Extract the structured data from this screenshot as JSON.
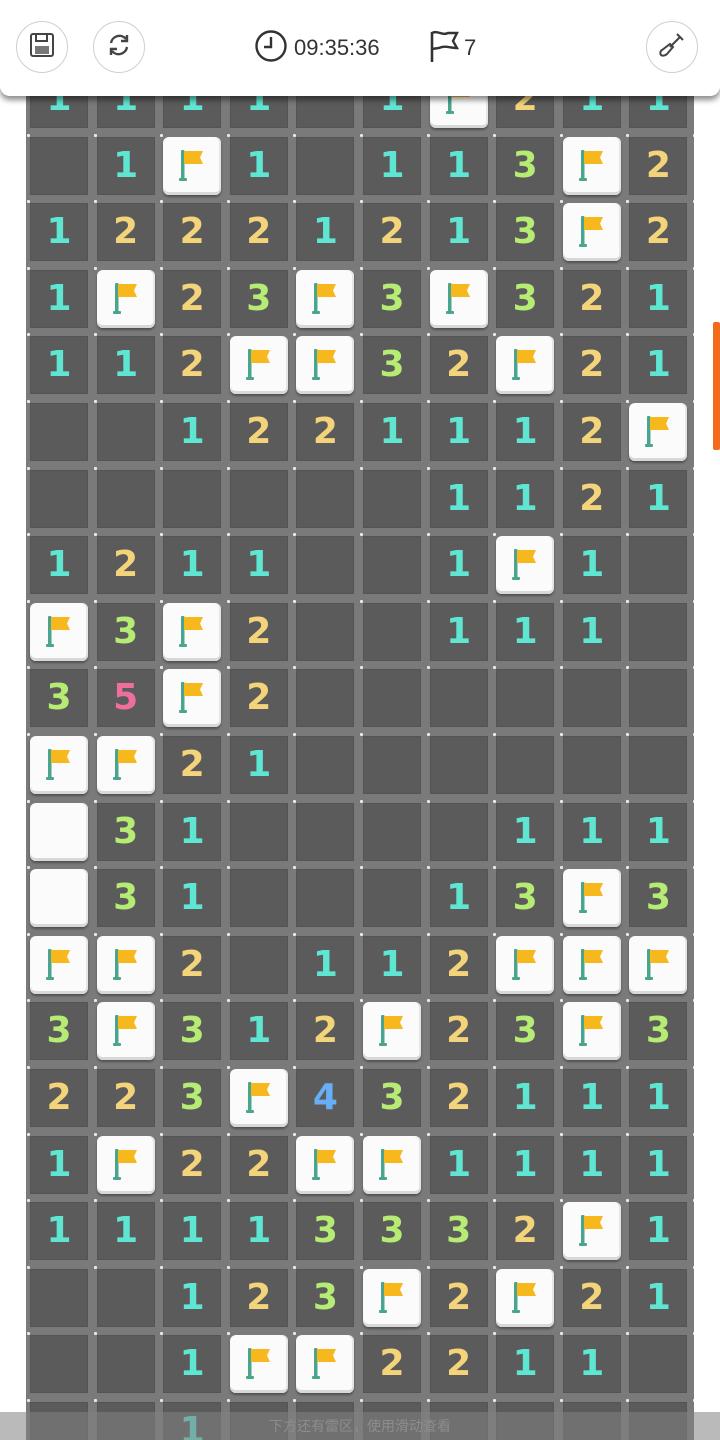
{
  "header": {
    "save_icon": "save-icon",
    "restart_icon": "restart-icon",
    "timer": "09:35:36",
    "flags_left": "7",
    "dig_icon": "shovel-icon"
  },
  "colors": {
    "1": "#5fe6d2",
    "2": "#f4d47a",
    "3": "#b6ec74",
    "4": "#68aef5",
    "5": "#ee6f9e",
    "flag": "#f7b81e",
    "pole": "#4aa58e",
    "accent": "#f26a1b"
  },
  "board": {
    "columns": 10,
    "legend": "F = flagged, H = unopened, . = opened empty, digit = adjacent mines",
    "rows": [
      "11111.1F211",
      "..1F1.113F2",
      "1222121 3F2",
      "1F23F3F321",
      "112FF32F21",
      "..122111 2F",
      "......1121",
      "1211..1F1.",
      "F3F2..111.",
      "35F2......",
      "FF21......",
      "H31....111",
      "H31...13F3",
      "FF2.112FFF",
      "3F312F23F3",
      "2230F4321 11",
      "1F22FF1111",
      "11113332F1",
      "..123F2F21",
      "..1FF22 11."
    ],
    "grid": [
      [
        "1",
        "1",
        "1",
        "1",
        ".",
        "1",
        "F",
        "2",
        "1",
        "1"
      ],
      [
        ".",
        "1",
        "F",
        "1",
        ".",
        "1",
        "1",
        "3",
        "F",
        "2"
      ],
      [
        "1",
        "2",
        "2",
        "2",
        "1",
        "2",
        "1",
        "3",
        "F",
        "2"
      ],
      [
        "1",
        "F",
        "2",
        "3",
        "F",
        "3",
        "F",
        "3",
        "2",
        "1"
      ],
      [
        "1",
        "1",
        "2",
        "F",
        "F",
        "3",
        "2",
        "F",
        "2",
        "1"
      ],
      [
        ".",
        ".",
        "1",
        "2",
        "2",
        "1",
        "1",
        "1",
        "2",
        "F"
      ],
      [
        ".",
        ".",
        ".",
        ".",
        ".",
        ".",
        "1",
        "1",
        "2",
        "1"
      ],
      [
        "1",
        "2",
        "1",
        "1",
        ".",
        ".",
        "1",
        "F",
        "1",
        "."
      ],
      [
        "F",
        "3",
        "F",
        "2",
        ".",
        ".",
        "1",
        "1",
        "1",
        "."
      ],
      [
        "3",
        "5",
        "F",
        "2",
        ".",
        ".",
        ".",
        ".",
        ".",
        "."
      ],
      [
        "F",
        "F",
        "2",
        "1",
        ".",
        ".",
        ".",
        ".",
        ".",
        "."
      ],
      [
        "H",
        "3",
        "1",
        ".",
        ".",
        ".",
        ".",
        "1",
        "1",
        "1"
      ],
      [
        "H",
        "3",
        "1",
        ".",
        ".",
        ".",
        "1",
        "3",
        "F",
        "3"
      ],
      [
        "F",
        "F",
        "2",
        ".",
        "1",
        "1",
        "2",
        "F",
        "F",
        "F"
      ],
      [
        "3",
        "F",
        "3",
        "1",
        "2",
        "F",
        "2",
        "3",
        "F",
        "3"
      ],
      [
        "2",
        "2",
        "3",
        "F",
        "4",
        "3",
        "2",
        "1",
        "1",
        "1"
      ],
      [
        "1",
        "F",
        "2",
        "2",
        "F",
        "F",
        "1",
        "1",
        "1",
        "1"
      ],
      [
        "1",
        "1",
        "1",
        "1",
        "3",
        "3",
        "3",
        "2",
        "F",
        "1"
      ],
      [
        ".",
        ".",
        "1",
        "2",
        "3",
        "F",
        "2",
        "F",
        "2",
        "1"
      ],
      [
        ".",
        ".",
        "1",
        "F",
        "F",
        "2",
        "2",
        "1",
        "1",
        "."
      ],
      [
        ".",
        ".",
        "1",
        ".",
        ".",
        ".",
        ".",
        ".",
        ".",
        "."
      ]
    ]
  },
  "footer": {
    "hint": "下方还有雷区，使用滑动查看"
  }
}
